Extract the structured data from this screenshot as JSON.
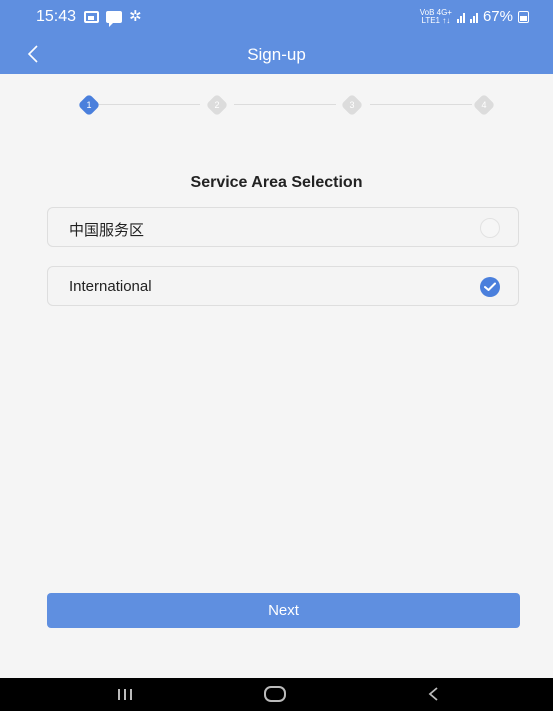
{
  "status_bar": {
    "time": "15:43",
    "network_top": "VoB 4G+",
    "network_bottom": "LTE1 ↑↓",
    "battery": "67%"
  },
  "header": {
    "title": "Sign-up",
    "back_icon": "chevron-left-icon"
  },
  "stepper": {
    "steps": [
      "1",
      "2",
      "3",
      "4"
    ],
    "active_step": 1
  },
  "section": {
    "title": "Service Area Selection"
  },
  "options": [
    {
      "label": "中国服务区",
      "selected": false
    },
    {
      "label": "International",
      "selected": true
    }
  ],
  "actions": {
    "next_label": "Next"
  },
  "colors": {
    "primary": "#5f8fe0",
    "accent": "#4a7fdc",
    "background": "#f5f5f5"
  }
}
